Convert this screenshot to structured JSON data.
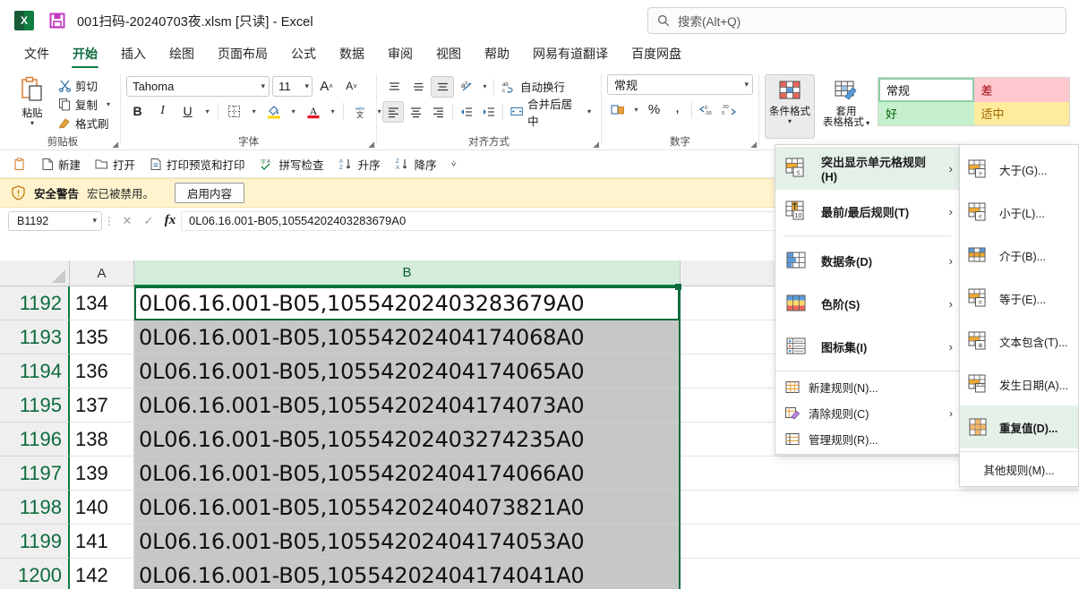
{
  "titlebar": {
    "file_name": "001扫码-20240703夜.xlsm",
    "read_only": "[只读]",
    "dash": "-",
    "app": "Excel",
    "search_placeholder": "搜索(Alt+Q)"
  },
  "tabs": [
    {
      "label": "文件",
      "active": false
    },
    {
      "label": "开始",
      "active": true
    },
    {
      "label": "插入",
      "active": false
    },
    {
      "label": "绘图",
      "active": false
    },
    {
      "label": "页面布局",
      "active": false
    },
    {
      "label": "公式",
      "active": false
    },
    {
      "label": "数据",
      "active": false
    },
    {
      "label": "审阅",
      "active": false
    },
    {
      "label": "视图",
      "active": false
    },
    {
      "label": "帮助",
      "active": false
    },
    {
      "label": "网易有道翻译",
      "active": false
    },
    {
      "label": "百度网盘",
      "active": false
    }
  ],
  "ribbon": {
    "clipboard": {
      "group_label": "剪贴板",
      "paste_label": "粘贴",
      "cut_label": "剪切",
      "copy_label": "复制",
      "format_painter_label": "格式刷"
    },
    "font": {
      "group_label": "字体",
      "font_name": "Tahoma",
      "font_size": "11"
    },
    "alignment": {
      "group_label": "对齐方式",
      "wrap_text_label": "自动换行",
      "merge_center_label": "合并后居中"
    },
    "number": {
      "group_label": "数字",
      "format_value": "常规"
    },
    "styles": {
      "conditional_formatting_label": "条件格式",
      "format_as_table_label": "套用\n表格格式",
      "format_as_table_line1": "套用",
      "format_as_table_line2": "表格格式",
      "gallery": [
        {
          "label": "常规",
          "bg": "#ffffff",
          "color": "#1a1a1a"
        },
        {
          "label": "差",
          "bg": "#ffc7ce",
          "color": "#9c0006"
        },
        {
          "label": "好",
          "bg": "#c6efce",
          "color": "#006100"
        },
        {
          "label": "适中",
          "bg": "#ffeb9c",
          "color": "#9c6500"
        }
      ]
    }
  },
  "quick_access": [
    {
      "label": "",
      "icon": "paste-icon"
    },
    {
      "label": "新建",
      "icon": "new-file-icon"
    },
    {
      "label": "打开",
      "icon": "open-folder-icon"
    },
    {
      "label": "打印预览和打印",
      "icon": "print-preview-icon"
    },
    {
      "label": "拼写检查",
      "icon": "spellcheck-icon"
    },
    {
      "label": "升序",
      "icon": "sort-asc-icon"
    },
    {
      "label": "降序",
      "icon": "sort-desc-icon"
    }
  ],
  "security_bar": {
    "title": "安全警告",
    "message": "宏已被禁用。",
    "button_label": "启用内容"
  },
  "formula_bar": {
    "name_box": "B1192",
    "formula": "0L06.16.001-B05,10554202403283679A0"
  },
  "grid": {
    "columns": [
      {
        "label": "A",
        "selected": false
      },
      {
        "label": "B",
        "selected": true
      }
    ],
    "rows": [
      {
        "row": "1192",
        "a": "134",
        "b": "0L06.16.001-B05,10554202403283679A0",
        "dup": false
      },
      {
        "row": "1193",
        "a": "135",
        "b": "0L06.16.001-B05,10554202404174068A0",
        "dup": true
      },
      {
        "row": "1194",
        "a": "136",
        "b": "0L06.16.001-B05,10554202404174065A0",
        "dup": true
      },
      {
        "row": "1195",
        "a": "137",
        "b": "0L06.16.001-B05,10554202404174073A0",
        "dup": true
      },
      {
        "row": "1196",
        "a": "138",
        "b": "0L06.16.001-B05,10554202403274235A0",
        "dup": true
      },
      {
        "row": "1197",
        "a": "139",
        "b": "0L06.16.001-B05,10554202404174066A0",
        "dup": true
      },
      {
        "row": "1198",
        "a": "140",
        "b": "0L06.16.001-B05,10554202404073821A0",
        "dup": true
      },
      {
        "row": "1199",
        "a": "141",
        "b": "0L06.16.001-B05,10554202404174053A0",
        "dup": true
      },
      {
        "row": "1200",
        "a": "142",
        "b": "0L06.16.001-B05,10554202404174041A0",
        "dup": true
      }
    ]
  },
  "menu": {
    "items": [
      {
        "label": "突出显示单元格规则(H)",
        "accel": "H",
        "arrow": "›",
        "highlight": true,
        "icon": "highlight-cells-rules-icon"
      },
      {
        "label": "最前/最后规则(T)",
        "accel": "T",
        "arrow": "›",
        "highlight": false,
        "icon": "top-bottom-rules-icon"
      },
      {
        "label": "数据条(D)",
        "accel": "D",
        "arrow": "›",
        "highlight": false,
        "icon": "data-bars-icon"
      },
      {
        "label": "色阶(S)",
        "accel": "S",
        "arrow": "›",
        "highlight": false,
        "icon": "color-scales-icon"
      },
      {
        "label": "图标集(I)",
        "accel": "I",
        "arrow": "›",
        "highlight": false,
        "icon": "icon-sets-icon"
      }
    ],
    "footer_items": [
      {
        "label": "新建规则(N)...",
        "arrow": "",
        "icon": "new-rule-icon"
      },
      {
        "label": "清除规则(C)",
        "arrow": "›",
        "icon": "clear-rules-icon"
      },
      {
        "label": "管理规则(R)...",
        "arrow": "",
        "icon": "manage-rules-icon"
      }
    ]
  },
  "submenu": {
    "items": [
      {
        "label": "大于(G)...",
        "highlight": false,
        "icon": "greater-than-icon"
      },
      {
        "label": "小于(L)...",
        "highlight": false,
        "icon": "less-than-icon"
      },
      {
        "label": "介于(B)...",
        "highlight": false,
        "icon": "between-icon"
      },
      {
        "label": "等于(E)...",
        "highlight": false,
        "icon": "equal-to-icon"
      },
      {
        "label": "文本包含(T)...",
        "highlight": false,
        "icon": "text-contains-icon"
      },
      {
        "label": "发生日期(A)...",
        "highlight": false,
        "icon": "date-occurring-icon"
      },
      {
        "label": "重复值(D)...",
        "highlight": true,
        "icon": "duplicate-values-icon"
      }
    ],
    "other_rules": "其他规则(M)..."
  },
  "colors": {
    "excel_green": "#107c41",
    "selection_green": "#0d6b3c",
    "header_selected": "#d3ecdc",
    "duplicate_gray": "#c7c7c7",
    "warning_bg": "#fff4ce",
    "menu_highlight": "#e4f0e8"
  }
}
